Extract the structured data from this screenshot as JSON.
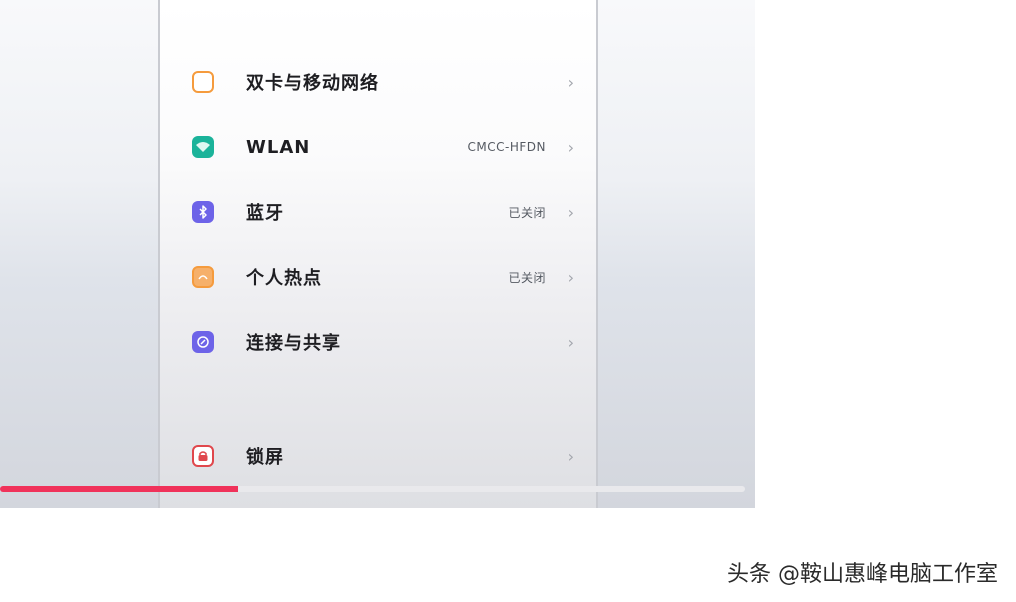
{
  "settings": {
    "items": [
      {
        "label": "双卡与移动网络",
        "value": "",
        "icon": "sim-card-icon",
        "color": "#f59b3d"
      },
      {
        "label": "WLAN",
        "value": "CMCC-HFDN",
        "icon": "wifi-icon",
        "color": "#1bb39a"
      },
      {
        "label": "蓝牙",
        "value": "已关闭",
        "icon": "bluetooth-icon",
        "color": "#6d63e8"
      },
      {
        "label": "个人热点",
        "value": "已关闭",
        "icon": "hotspot-icon",
        "color": "#f59b3d"
      },
      {
        "label": "连接与共享",
        "value": "",
        "icon": "link-share-icon",
        "color": "#6d63e8"
      },
      {
        "label": "锁屏",
        "value": "",
        "icon": "lock-screen-icon",
        "color": "#e0474c"
      }
    ],
    "chevron": "›"
  },
  "video": {
    "progress": 0.32,
    "progress_color": "#f0325a"
  },
  "watermark": {
    "text": "头条 @鞍山惠峰电脑工作室"
  }
}
